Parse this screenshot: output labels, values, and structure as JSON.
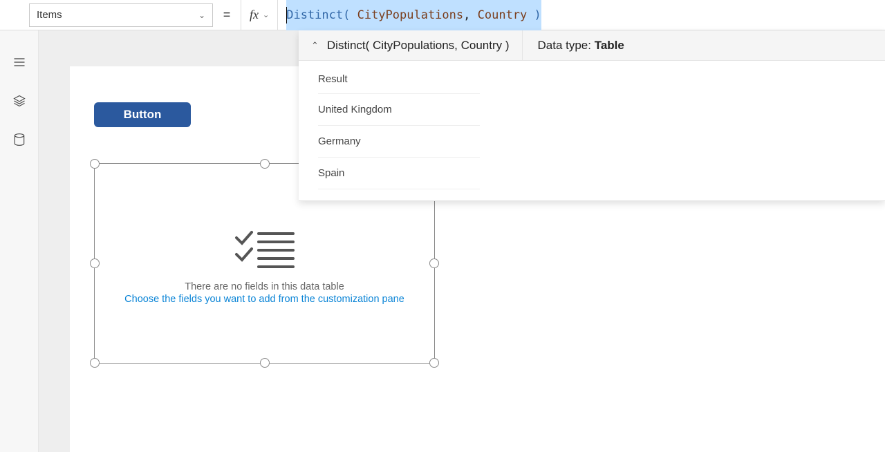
{
  "formula_bar": {
    "property": "Items",
    "fx_label": "fx",
    "tokens": {
      "fn": "Distinct",
      "open": "( ",
      "arg1": "CityPopulations",
      "comma": ",",
      "sp": " ",
      "arg2": "Country",
      "sp2": " ",
      "close": ")"
    }
  },
  "intellisense": {
    "signature": "Distinct( CityPopulations, Country )",
    "data_type_label": "Data type: ",
    "data_type_value": "Table",
    "result_header": "Result",
    "rows": [
      "United Kingdom",
      "Germany",
      "Spain"
    ]
  },
  "canvas": {
    "button_label": "Button",
    "empty_line1": "There are no fields in this data table",
    "empty_line2": "Choose the fields you want to add from the customization pane"
  },
  "rail": {
    "icons": [
      "menu-icon",
      "layers-icon",
      "database-icon"
    ]
  },
  "chart_data": {
    "type": "table",
    "title": "Distinct( CityPopulations, Country )",
    "columns": [
      "Result"
    ],
    "rows": [
      [
        "United Kingdom"
      ],
      [
        "Germany"
      ],
      [
        "Spain"
      ]
    ]
  }
}
